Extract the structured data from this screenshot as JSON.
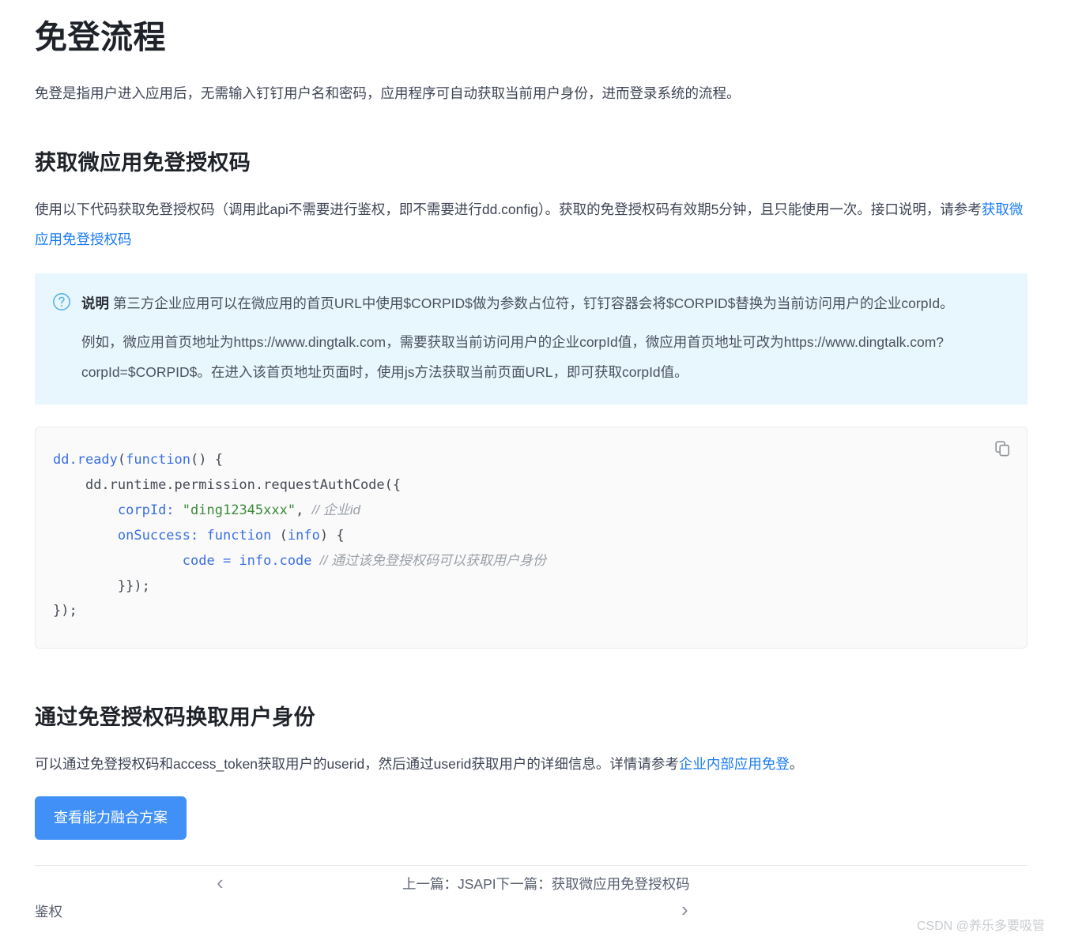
{
  "page": {
    "title": "免登流程",
    "lead": "免登是指用户进入应用后，无需输入钉钉用户名和密码，应用程序可自动获取当前用户身份，进而登录系统的流程。"
  },
  "section_auth_code": {
    "heading": "获取微应用免登授权码",
    "intro_before_link": "使用以下代码获取免登授权码（调用此api不需要进行鉴权，即不需要进行dd.config）。获取的免登授权码有效期5分钟，且只能使用一次。接口说明，请参考",
    "intro_link": "获取微应用免登授权码"
  },
  "note": {
    "icon": "question-circle-icon",
    "label": "说明",
    "text": "第三方企业应用可以在微应用的首页URL中使用$CORPID$做为参数占位符，钉钉容器会将$CORPID$替换为当前访问用户的企业corpId。",
    "example": "例如，微应用首页地址为https://www.dingtalk.com，需要获取当前访问用户的企业corpId值，微应用首页地址可改为https://www.dingtalk.com?corpId=$CORPID$。在进入该首页地址页面时，使用js方法获取当前页面URL，即可获取corpId值。",
    "background": "#e8f6fd",
    "icon_color": "#4fb0e8"
  },
  "code_block": {
    "copy_icon": "copy-icon",
    "language": "javascript",
    "background": "#fafafa",
    "lines": [
      "dd.ready(function() {",
      "    dd.runtime.permission.requestAuthCode({",
      "        corpId: \"ding12345xxx\", // 企业id",
      "        onSuccess: function (info) {",
      "                code = info.code // 通过该免登授权码可以获取用户身份",
      "        }});",
      "});"
    ],
    "tokens": {
      "fn_name": "dd.ready",
      "keyword_function": "function",
      "prop_corpid": "corpId:",
      "string_corpid": "\"ding12345xxx\"",
      "comment_corpid": "// 企业id",
      "prop_onsuccess": "onSuccess:",
      "param_info": "info",
      "expr_code": "code = info.code",
      "comment_code": "// 通过该免登授权码可以获取用户身份"
    }
  },
  "section_exchange": {
    "heading": "通过免登授权码换取用户身份",
    "text_before_link": "可以通过免登授权码和access_token获取用户的userid，然后通过userid获取用户的详细信息。详情请参考",
    "link": "企业内部应用免登",
    "text_after_link": "。",
    "button_label": "查看能力融合方案",
    "button_color": "#4090f7"
  },
  "footer_nav": {
    "prev_label": "鉴权",
    "chevron_left": "‹",
    "center_text": "上一篇：JSAPI下一篇：获取微应用免登授权码",
    "chevron_right": "›"
  },
  "watermark": {
    "text": "CSDN @养乐多要吸管"
  }
}
